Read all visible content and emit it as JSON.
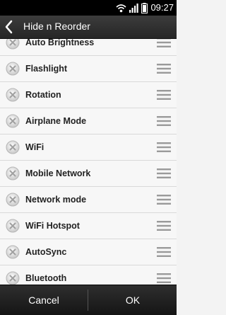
{
  "status_bar": {
    "time": "09:27",
    "icons": [
      "wifi-icon",
      "signal-icon",
      "battery-icon"
    ]
  },
  "header": {
    "back_icon": "back-chevron-icon",
    "title": "Hide n Reorder"
  },
  "list": {
    "row_icons": {
      "left": "remove-circle-icon",
      "right": "drag-handle-icon"
    },
    "items": [
      {
        "label": "Auto Brightness"
      },
      {
        "label": "Flashlight"
      },
      {
        "label": "Rotation"
      },
      {
        "label": "Airplane Mode"
      },
      {
        "label": "WiFi"
      },
      {
        "label": "Mobile Network"
      },
      {
        "label": "Network mode"
      },
      {
        "label": "WiFi Hotspot"
      },
      {
        "label": "AutoSync"
      },
      {
        "label": "Bluetooth"
      }
    ]
  },
  "footer": {
    "cancel_label": "Cancel",
    "ok_label": "OK"
  },
  "colors": {
    "status_bar": "#000000",
    "title_bar": "#2f2f2f",
    "list_background": "#f7f7f7",
    "row_separator": "#d9d9d9",
    "bottom_bar": "#1e1e1e"
  }
}
